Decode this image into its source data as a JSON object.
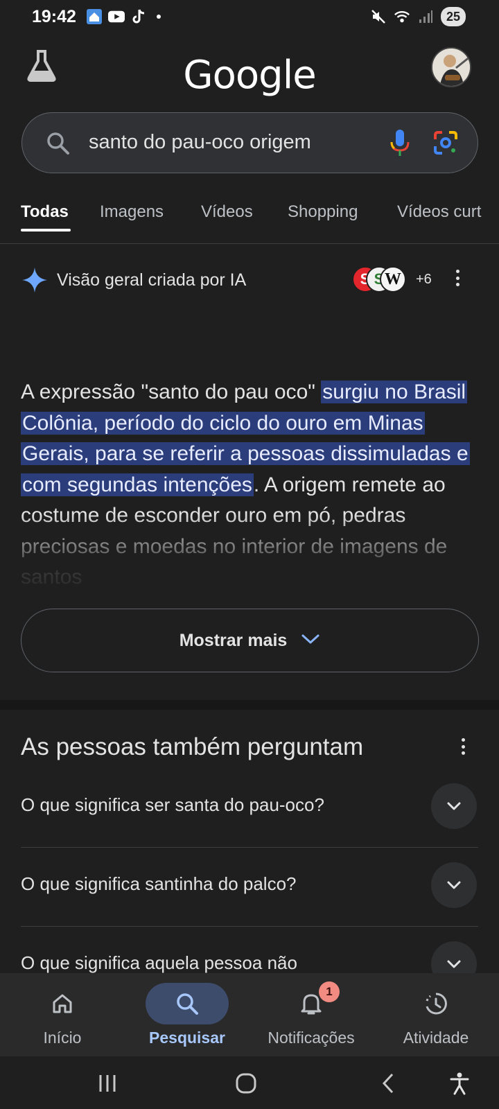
{
  "status_bar": {
    "time": "19:42",
    "battery": "25",
    "left_icons": [
      "home-app-icon",
      "youtube-icon",
      "tiktok-icon",
      "notification-dot"
    ],
    "right_icons": [
      "mute-icon",
      "wifi-icon",
      "signal-icon",
      "battery-icon"
    ]
  },
  "header": {
    "logo": "Google",
    "lab_icon": "flask-icon",
    "avatar": "profile-avatar"
  },
  "search": {
    "query": "santo do pau-oco origem",
    "icons": [
      "search-icon",
      "mic-icon",
      "lens-icon"
    ]
  },
  "tabs": [
    {
      "label": "Todas",
      "active": true
    },
    {
      "label": "Imagens",
      "active": false
    },
    {
      "label": "Vídeos",
      "active": false
    },
    {
      "label": "Shopping",
      "active": false
    },
    {
      "label": "Vídeos curt",
      "active": false
    }
  ],
  "ai_overview": {
    "title": "Visão geral criada por IA",
    "sources_more": "+6",
    "text_before": "A expressão \"santo do pau oco\" ",
    "text_highlight": "surgiu no Brasil Colônia, período do ciclo do ouro em Minas Gerais, para se referir a pessoas dissimuladas e com segundas intenções",
    "text_after": ". A origem remete ao costume de esconder ouro em pó, pedras preciosas e moedas no interior de imagens de santos",
    "show_more": "Mostrar mais"
  },
  "people_also_ask": {
    "title": "As pessoas também perguntam",
    "questions": [
      "O que significa ser santa do pau-oco?",
      "O que significa santinha do palco?",
      "O que significa aquela pessoa não"
    ]
  },
  "bottom_nav": {
    "items": [
      {
        "label": "Início",
        "icon": "home-icon",
        "active": false
      },
      {
        "label": "Pesquisar",
        "icon": "search-icon",
        "active": true
      },
      {
        "label": "Notificações",
        "icon": "bell-icon",
        "active": false,
        "badge": "1"
      },
      {
        "label": "Atividade",
        "icon": "activity-icon",
        "active": false
      }
    ]
  },
  "colors": {
    "background": "#1f1f1f",
    "highlight": "#2c3d7c",
    "active_nav": "#3d4c6b",
    "active_nav_text": "#a8c7fa"
  }
}
